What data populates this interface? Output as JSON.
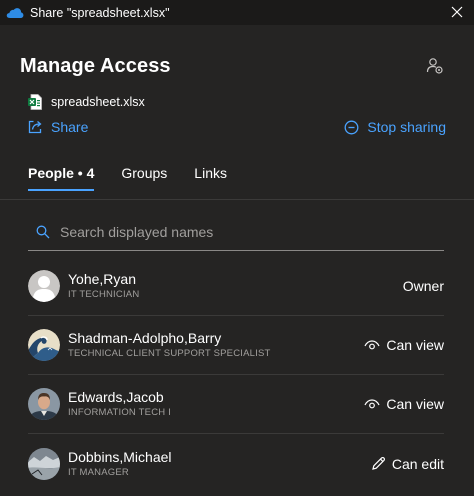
{
  "window": {
    "title": "Share \"spreadsheet.xlsx\""
  },
  "header": {
    "title": "Manage Access"
  },
  "file": {
    "name": "spreadsheet.xlsx"
  },
  "actions": {
    "share_label": "Share",
    "stop_label": "Stop sharing"
  },
  "tabs": [
    {
      "label": "People • 4",
      "active": true
    },
    {
      "label": "Groups",
      "active": false
    },
    {
      "label": "Links",
      "active": false
    }
  ],
  "search": {
    "placeholder": "Search displayed names",
    "value": ""
  },
  "people": [
    {
      "name": "Yohe,Ryan",
      "role": "IT TECHNICIAN",
      "permission": "Owner",
      "permission_icon": "none"
    },
    {
      "name": "Shadman-Adolpho,Barry",
      "role": "TECHNICAL CLIENT SUPPORT SPECIALIST",
      "permission": "Can view",
      "permission_icon": "eye-icon"
    },
    {
      "name": "Edwards,Jacob",
      "role": "INFORMATION TECH I",
      "permission": "Can view",
      "permission_icon": "eye-icon"
    },
    {
      "name": "Dobbins,Michael",
      "role": "IT MANAGER",
      "permission": "Can edit",
      "permission_icon": "pencil-icon"
    }
  ],
  "colors": {
    "accent": "#4aa3ff",
    "background": "#252423",
    "titlebar": "#1b1a19",
    "muted_text": "#a19f9d"
  }
}
